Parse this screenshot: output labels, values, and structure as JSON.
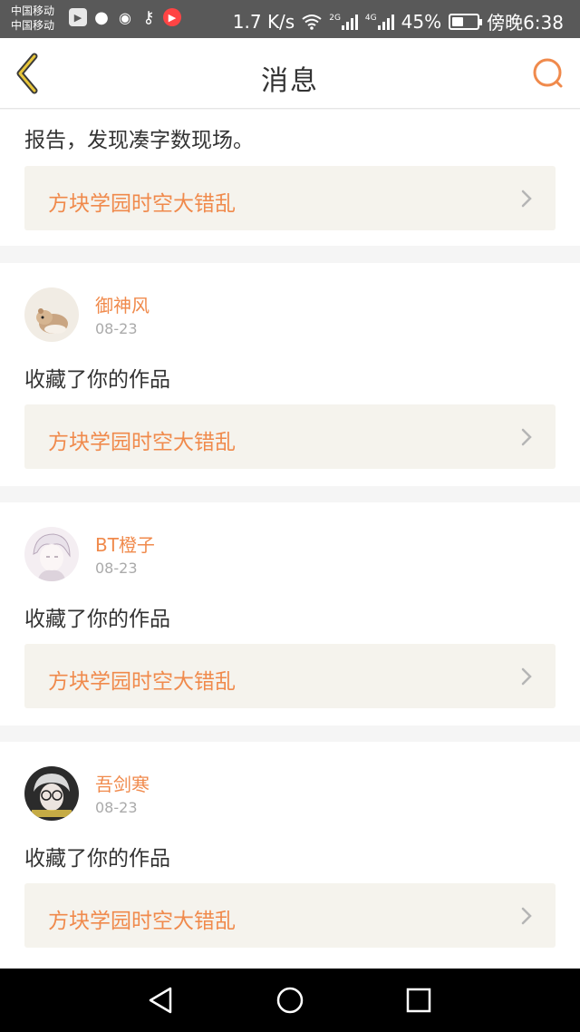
{
  "status_bar": {
    "carrier_1": "中国移动",
    "carrier_2": "中国移动",
    "speed": "1.7 K/s",
    "network_1": "2G",
    "network_2": "4G",
    "battery_percent": "45%",
    "battery_level": 0.45,
    "time": "傍晚6:38"
  },
  "header": {
    "title": "消息",
    "accent_color": "#f08a4c",
    "back_icon": "chevron-left-icon",
    "search_icon": "search-icon"
  },
  "messages": [
    {
      "text": "报告，发现凑字数现场。",
      "work_title": "方块学园时空大错乱"
    },
    {
      "username": "御神风",
      "date": "08-23",
      "action": "收藏了你的作品",
      "work_title": "方块学园时空大错乱"
    },
    {
      "username": "BT橙子",
      "date": "08-23",
      "action": "收藏了你的作品",
      "work_title": "方块学园时空大错乱"
    },
    {
      "username": "吾剑寒",
      "date": "08-23",
      "action": "收藏了你的作品",
      "work_title": "方块学园时空大错乱"
    }
  ]
}
